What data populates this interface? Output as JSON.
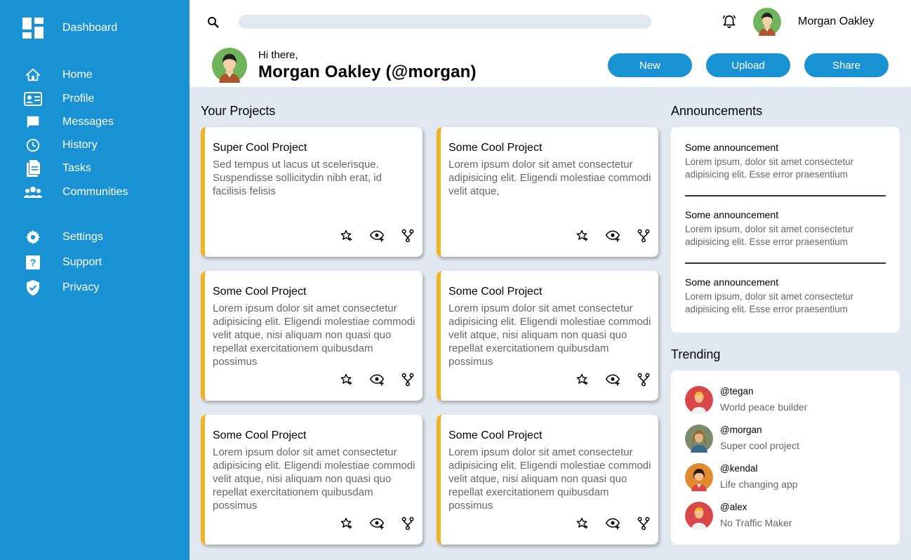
{
  "sidebar": {
    "brand": {
      "icon": "dashboard-icon",
      "label": "Dashboard"
    },
    "items": [
      {
        "icon": "home-icon",
        "label": "Home"
      },
      {
        "icon": "profile-card-icon",
        "label": "Profile"
      },
      {
        "icon": "messages-icon",
        "label": "Messages"
      },
      {
        "icon": "history-icon",
        "label": "History"
      },
      {
        "icon": "tasks-icon",
        "label": "Tasks"
      },
      {
        "icon": "communities-icon",
        "label": "Communities"
      }
    ],
    "secondary_items": [
      {
        "icon": "gear-icon",
        "label": "Settings"
      },
      {
        "icon": "help-icon",
        "label": "Support"
      },
      {
        "icon": "shield-icon",
        "label": "Privacy"
      }
    ]
  },
  "header": {
    "search_placeholder": "",
    "user_name": "Morgan Oakley",
    "greeting": "Hi there,",
    "full_name": "Morgan Oakley (@morgan)",
    "buttons": {
      "new": "New",
      "upload": "Upload",
      "share": "Share"
    }
  },
  "projects": {
    "title": "Your Projects",
    "cards": [
      {
        "title": "Super Cool Project",
        "description": "Sed tempus ut lacus ut scelerisque. Suspendisse sollicitydin nibh erat, id facilisis felisis"
      },
      {
        "title": "Some Cool Project",
        "description": "Lorem ipsum dolor sit amet consectetur adipisicing elit. Eligendi molestiae commodi velit atque,"
      },
      {
        "title": "Some Cool Project",
        "description": "Lorem ipsum dolor sit amet consectetur adipisicing elit. Eligendi molestiae commodi velit atque, nisi aliquam non quasi quo repellat exercitationem quibusdam possimus"
      },
      {
        "title": "Some Cool Project",
        "description": "Lorem ipsum dolor sit amet consectetur adipisicing elit. Eligendi molestiae commodi velit atque, nisi aliquam non quasi quo repellat exercitationem quibusdam possimus"
      },
      {
        "title": "Some Cool Project",
        "description": "Lorem ipsum dolor sit amet consectetur adipisicing elit. Eligendi molestiae commodi velit atque, nisi aliquam non quasi quo repellat exercitationem quibusdam possimus"
      },
      {
        "title": "Some Cool Project",
        "description": "Lorem ipsum dolor sit amet consectetur adipisicing elit. Eligendi molestiae commodi velit atque, nisi aliquam non quasi quo repellat exercitationem quibusdam possimus"
      }
    ],
    "card_action_icons": [
      "star-add-icon",
      "watch-eye-icon",
      "fork-icon"
    ]
  },
  "announcements": {
    "title": "Announcements",
    "items": [
      {
        "title": "Some announcement",
        "text": "Lorem ipsum, dolor sit amet consectetur adipisicing elit. Esse error praesentium"
      },
      {
        "title": "Some announcement",
        "text": "Lorem ipsum, dolor sit amet consectetur adipisicing elit. Esse error praesentium"
      },
      {
        "title": "Some announcement",
        "text": "Lorem ipsum, dolor sit amet consectetur adipisicing elit. Esse error praesentium"
      }
    ]
  },
  "trending": {
    "title": "Trending",
    "items": [
      {
        "handle": "@tegan",
        "description": "World peace builder"
      },
      {
        "handle": "@morgan",
        "description": "Super cool project"
      },
      {
        "handle": "@kendal",
        "description": "Life changing app"
      },
      {
        "handle": "@alex",
        "description": "No Traffic Maker"
      }
    ]
  },
  "colors": {
    "sidebar": "#1992d4",
    "accent": "#f0b429",
    "background": "#e2e8f0",
    "card": "#ffffff"
  }
}
